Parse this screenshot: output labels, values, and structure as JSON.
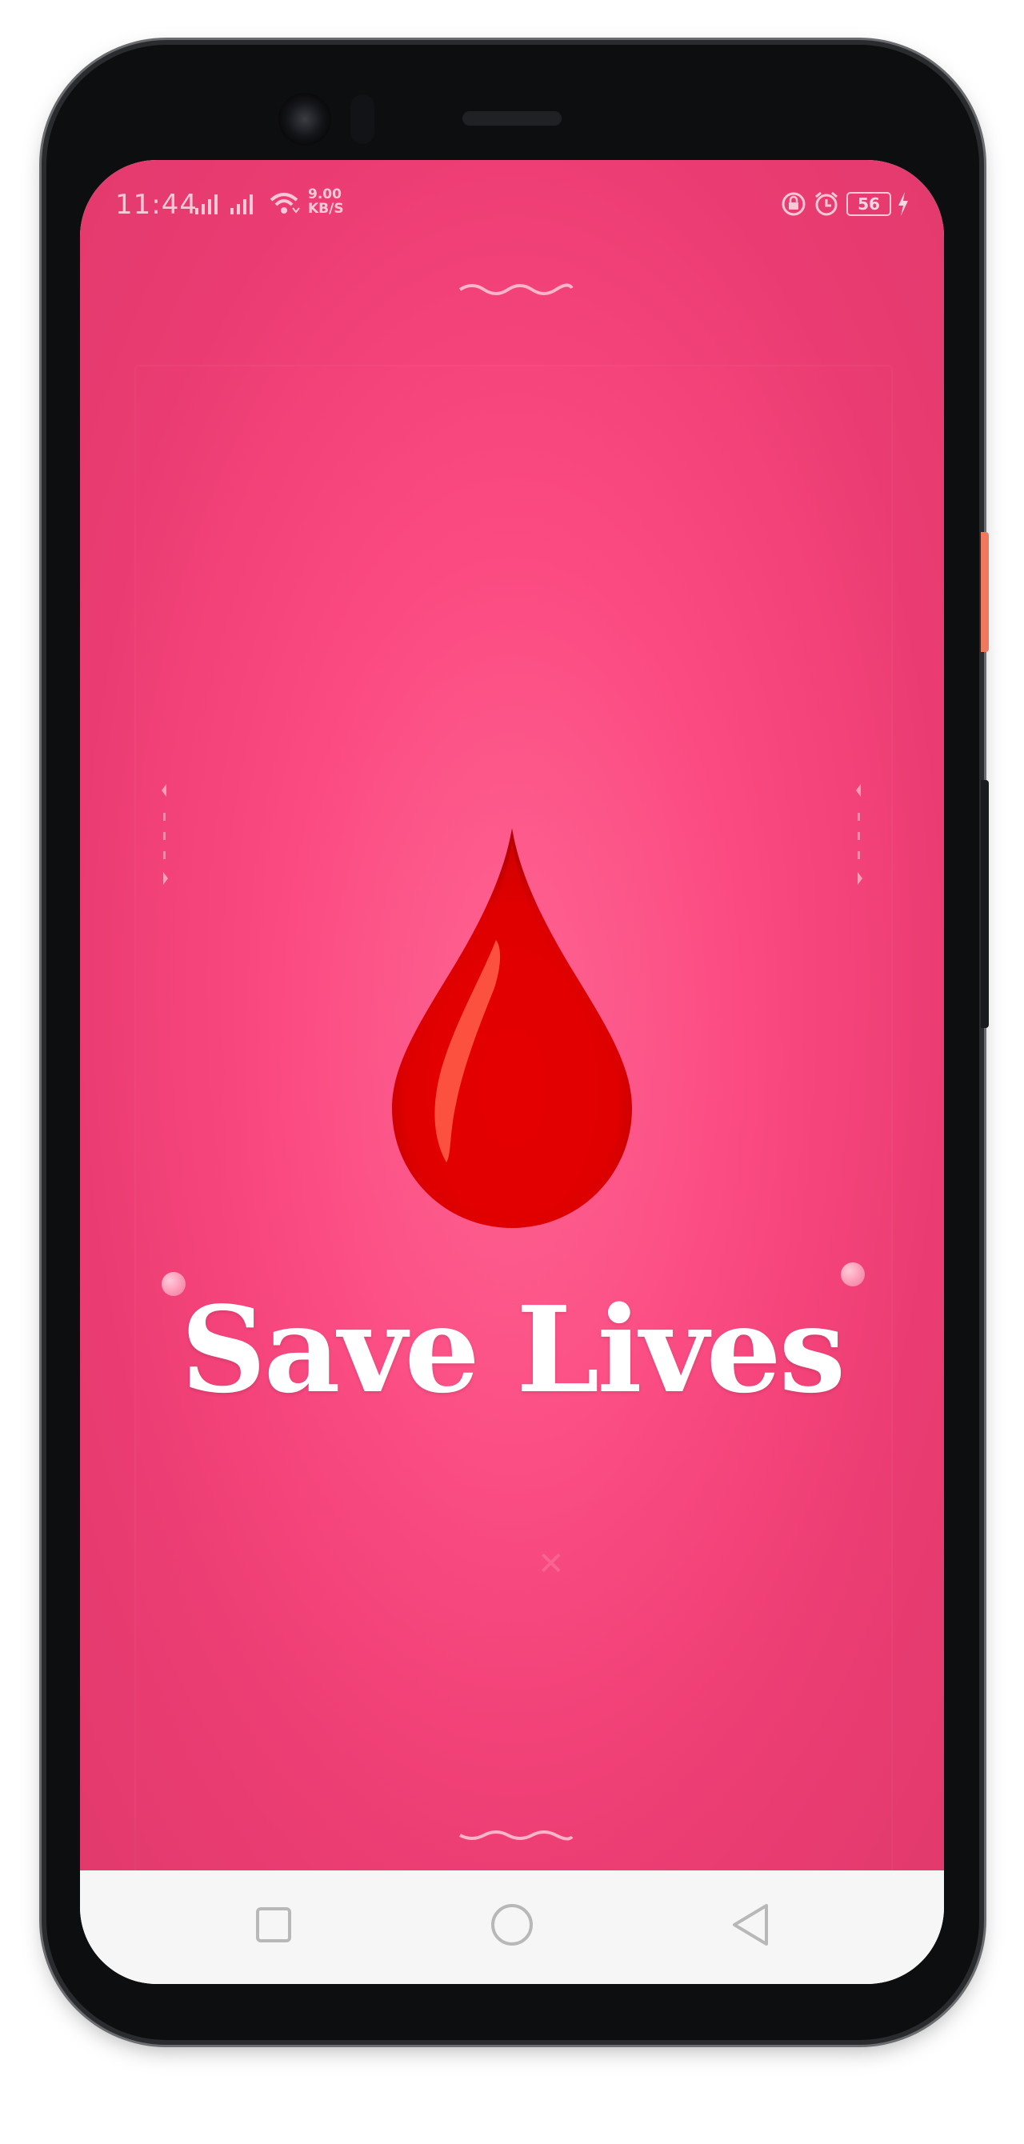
{
  "status_bar": {
    "time": "11:44",
    "network_speed_value": "9.00",
    "network_speed_unit": "KB/S",
    "battery_level": "56",
    "icons": [
      "signal-icon",
      "signal-icon",
      "wifi-icon",
      "lock-rotation-icon",
      "alarm-icon",
      "battery-icon",
      "charging-icon"
    ]
  },
  "splash": {
    "headline": "Save Lives",
    "logo_icon": "blood-drop-icon"
  },
  "nav_bar": {
    "buttons": [
      "recents-icon",
      "home-icon",
      "back-icon"
    ]
  },
  "colors": {
    "background_center": "#ff5c8d",
    "background_edge": "#e23a6d",
    "drop_red": "#e00000",
    "drop_highlight": "#ff5a45",
    "headline": "#ffffff",
    "nav_bar": "#f6f6f6"
  }
}
